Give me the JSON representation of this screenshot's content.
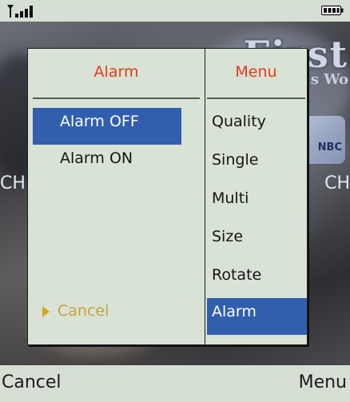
{
  "status": {
    "signal_icon": "signal-strength-icon",
    "battery_icon": "battery-icon"
  },
  "viewfinder": {
    "banner_main": "First",
    "banner_sub": "s Wo",
    "side_left": "CH",
    "side_right": "CH",
    "badge_text": "NBC"
  },
  "left_panel": {
    "title": "Alarm",
    "items": [
      {
        "label": "Alarm OFF",
        "selected": true
      },
      {
        "label": "Alarm ON",
        "selected": false
      }
    ],
    "cancel_label": "Cancel"
  },
  "right_panel": {
    "title": "Menu",
    "items": [
      {
        "label": "Quality",
        "selected": false
      },
      {
        "label": "Single",
        "selected": false
      },
      {
        "label": "Multi",
        "selected": false
      },
      {
        "label": "Size",
        "selected": false
      },
      {
        "label": "Rotate",
        "selected": false
      },
      {
        "label": "Alarm",
        "selected": true
      }
    ]
  },
  "softkeys": {
    "left": "Cancel",
    "right": "Menu"
  },
  "colors": {
    "panel_bg": "#d8e3d5",
    "highlight": "#315fae",
    "title": "#e8391a",
    "cancel": "#c6a33a"
  }
}
